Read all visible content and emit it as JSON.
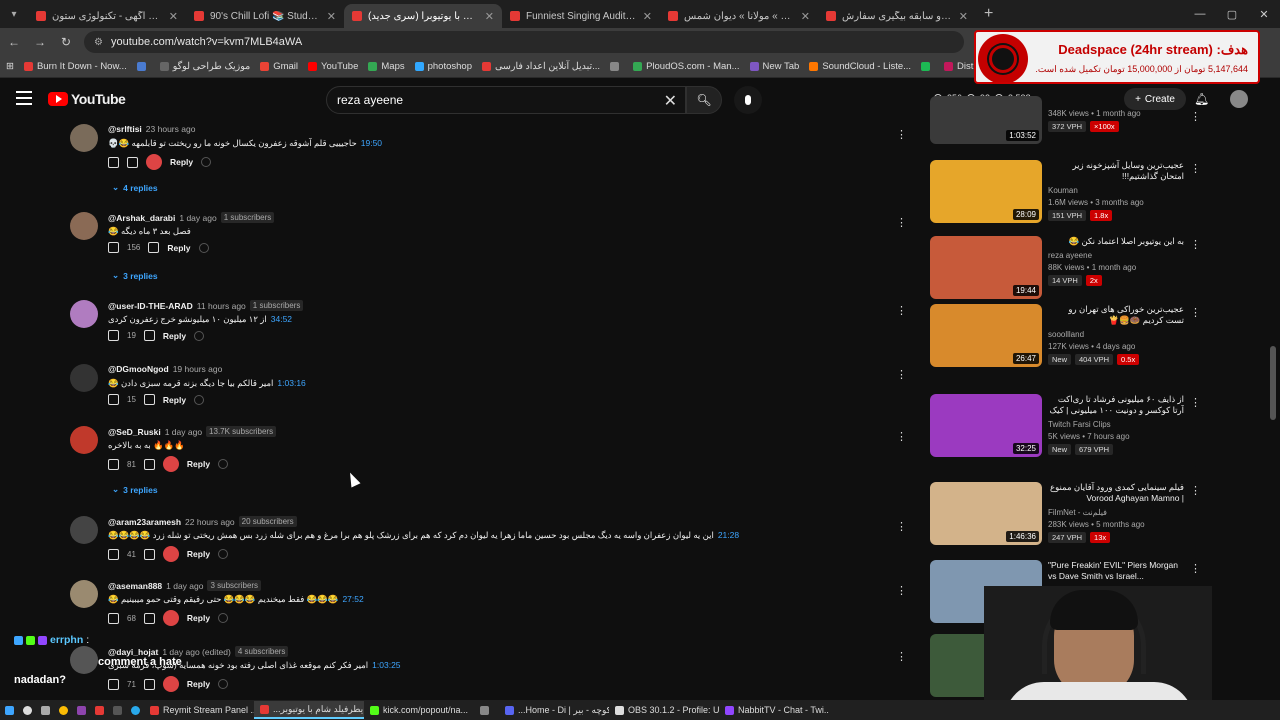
{
  "browser": {
    "tabs": [
      {
        "title": "سیاست آگهی - تکنولوژی ستون",
        "color": "#e53935",
        "active": false
      },
      {
        "title": "90's Chill Lofi 📚 Study Music",
        "color": "#e53935",
        "active": false
      },
      {
        "title": "(سری جدید) یطرفیلد شام با یوتیوبرا",
        "color": "#e53935",
        "active": true
      },
      {
        "title": "Funniest Singing Audition EVER",
        "color": "#e53935",
        "active": false
      },
      {
        "title": "کنجور » مولانا » دیوان شمس »",
        "color": "#e53935",
        "active": false
      },
      {
        "title": "مشخصات و سابقه بیگیری سفارش",
        "color": "#e53935",
        "active": false
      }
    ],
    "url": "youtube.com/watch?v=kvm7MLB4aWA",
    "bookmarks": [
      {
        "label": "Burn It Down - Now...",
        "color": "#e53935"
      },
      {
        "label": "",
        "color": "#4a7bd0"
      },
      {
        "label": "موزیک طراحی لوگو",
        "color": "#666"
      },
      {
        "label": "Gmail",
        "color": "#ea4335"
      },
      {
        "label": "YouTube",
        "color": "#ff0000"
      },
      {
        "label": "Maps",
        "color": "#34a853"
      },
      {
        "label": "photoshop",
        "color": "#31a8ff"
      },
      {
        "label": "تبدیل آنلاین اعداد فارسی...",
        "color": "#e53935"
      },
      {
        "label": "",
        "color": "#888"
      },
      {
        "label": "PloudOS.com - Man...",
        "color": "#34a853"
      },
      {
        "label": "New Tab",
        "color": "#7e57c2"
      },
      {
        "label": "SoundCloud - Liste...",
        "color": "#ff7700"
      },
      {
        "label": "",
        "color": "#1db954"
      },
      {
        "label": "Distribution | Route...",
        "color": "#c2185b"
      }
    ]
  },
  "youtube": {
    "logo_text": "YouTube",
    "search_value": "reza ayeene",
    "stats": [
      "356",
      "92",
      "3,538"
    ],
    "create_label": "Create"
  },
  "donation": {
    "goal_title": "هدف: Deadspace (24hr stream)",
    "goal_progress": "5,147,644 تومان از 15,000,000 تومان تکمیل شده است."
  },
  "comments": [
    {
      "author": "@srlftisi",
      "time": "23 hours ago",
      "subs": "",
      "text": "حاجیییی قلم آشوقه زعفرون یکسال خونه ما رو ریختت تو قابلمهه 😂💀",
      "timestamp": "19:50",
      "likes": "",
      "replies": "4 replies",
      "avatar": "#7a6b5a"
    },
    {
      "author": "@Arshak_darabi",
      "time": "1 day ago",
      "subs": "1 subscribers",
      "text": "فصل بعد ۳ ماه دیگه 😂",
      "timestamp": "",
      "likes": "156",
      "replies": "3 replies",
      "avatar": "#8a6a55"
    },
    {
      "author": "@user-ID-THE-ARAD",
      "time": "11 hours ago",
      "subs": "1 subscribers",
      "text": "از ۱۲ میلیون ۱۰ میلیونشو خرج زعفرون کردی",
      "timestamp": "34:52",
      "likes": "19",
      "replies": "",
      "avatar": "#b07cc0"
    },
    {
      "author": "@DGmooNgod",
      "time": "19 hours ago",
      "subs": "",
      "text": "امیر قالکم بیا جا دیگه بزنه قرمه سبزی دادن 😂",
      "timestamp": "1:03:16",
      "likes": "15",
      "replies": "",
      "avatar": "#333"
    },
    {
      "author": "@SeD_Ruski",
      "time": "1 day ago",
      "subs": "13.7K subscribers",
      "text": "🔥🔥🔥 به به بالاخره",
      "timestamp": "",
      "likes": "81",
      "replies": "3 replies",
      "avatar": "#c0392b"
    },
    {
      "author": "@aram23aramesh",
      "time": "22 hours ago",
      "subs": "20 subscribers",
      "text": "این یه لیوان زعفران واسه یه دیگ مجلس بود حسین ماما زهرا یه لیوان دم کرد که هم برای زرشک پلو هم برا مرغ و هم برای شله زرد بس همش ریختی تو شله زرد 😂😂😂😂",
      "timestamp": "21:28",
      "likes": "41",
      "replies": "",
      "avatar": "#444"
    },
    {
      "author": "@aseman888",
      "time": "1 day ago",
      "subs": "3 subscribers",
      "text": "😂😂😂 فقط میخندیم 😂😂😂 حتی رفیقم وقتی حمو میبینیم 😂",
      "timestamp": "27:52",
      "likes": "68",
      "replies": "",
      "avatar": "#9a8a70"
    },
    {
      "author": "@dayi_hojat",
      "time": "1 day ago (edited)",
      "subs": "4 subscribers",
      "text": "امیر فکر کنم موقعه غذای اصلی رفته بود خونه همسایه (سوپ، قرمه سبزی",
      "timestamp": "1:03:25",
      "likes": "71",
      "replies": "",
      "avatar": "#555"
    }
  ],
  "sidebar": [
    {
      "title": "",
      "channel": "",
      "views": "348K views • 1 month ago",
      "tags": [
        "372 VPH",
        "×100x"
      ],
      "duration": "1:03:52",
      "thumb": "#3a3a3a"
    },
    {
      "title": "عجیب‌ترین وسایل آشپزخونه زیر امتحان گذاشتیم!!!",
      "channel": "Kouman",
      "views": "1.6M views • 3 months ago",
      "tags": [
        "151 VPH",
        "1.8x"
      ],
      "duration": "28:09",
      "thumb": "#e6a62a"
    },
    {
      "title": "به این یوتیوبر اصلا اعتماد نکن 😂",
      "channel": "reza ayeene",
      "views": "88K views • 1 month ago",
      "tags": [
        "14 VPH",
        "2x"
      ],
      "duration": "19:44",
      "thumb": "#c75a3a"
    },
    {
      "title": "عجیب‌ترین خوراکی های تهران رو تست کردیم 🍩🍔🍟",
      "channel": "sooollland",
      "views": "127K views • 4 days ago",
      "tags": [
        "New",
        "404 VPH",
        "0.5x"
      ],
      "duration": "26:47",
      "thumb": "#d88a2c"
    },
    {
      "title": "از ذایف ۶۰ میلیونی فرشاد تا ری‌اکت آرتا کوکسر و دونیت ۱۰۰ میلیونی | کیک + ...",
      "channel": "Twitch Farsi Clips",
      "views": "5K views • 7 hours ago",
      "tags": [
        "New",
        "679 VPH"
      ],
      "duration": "32:25",
      "thumb": "#9b3ac0"
    },
    {
      "title": "فیلم سینمایی کمدی ورود آقایان ممنوع | Vorood Aghayan Mamno",
      "channel": "FilmNet - فیلم‌نت",
      "views": "283K views • 5 months ago",
      "tags": [
        "247 VPH",
        "13x"
      ],
      "duration": "1:46:36",
      "thumb": "#d3b38a"
    },
    {
      "title": "\"Pure Freakin' EVIL\" Piers Morgan vs Dave Smith vs Israel...",
      "channel": "",
      "views": "",
      "tags": [],
      "duration": "",
      "thumb": "#7f97b0"
    },
    {
      "title": "",
      "channel": "",
      "views": "",
      "tags": [],
      "duration": "",
      "thumb": "#3d5a3a"
    }
  ],
  "chat": {
    "user": "errphn",
    "msg": "comment a hate",
    "line2": "nadadan?"
  },
  "taskbar": {
    "apps": [
      {
        "label": "Reymit Stream Panel ...",
        "color": "#e53935",
        "active": false
      },
      {
        "label": "یطرفیلد شام با یوتیوبر...",
        "color": "#e53935",
        "active": true
      },
      {
        "label": "kick.com/popout/na...",
        "color": "#53fc18",
        "active": false
      },
      {
        "label": "",
        "color": "#888",
        "active": false
      },
      {
        "label": "#کوچه - بیر | Home - Di...",
        "color": "#5865f2",
        "active": false
      },
      {
        "label": "OBS 30.1.2 - Profile: U...",
        "color": "#ddd",
        "active": false
      },
      {
        "label": "NabbitTV - Chat - Twi...",
        "color": "#9146ff",
        "active": false
      }
    ]
  }
}
